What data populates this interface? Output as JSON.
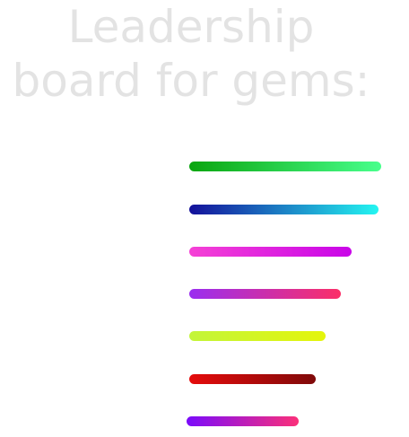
{
  "title": {
    "line1": "Leadership",
    "line2": "board for gems:"
  },
  "leaderboard": {
    "max_value": 1.0,
    "bars": [
      {
        "value": 1.0,
        "color_start": "#0aa50f",
        "color_end": "#48ff8c"
      },
      {
        "value": 0.986,
        "color_start": "#14109a",
        "color_end": "#24f5f1"
      },
      {
        "value": 0.845,
        "color_start": "#f541d5",
        "color_end": "#c905e8"
      },
      {
        "value": 0.79,
        "color_start": "#9a2ef0",
        "color_end": "#fb2f68"
      },
      {
        "value": 0.71,
        "color_start": "#c3f53a",
        "color_end": "#e4f50b"
      },
      {
        "value": 0.66,
        "color_start": "#e50b0b",
        "color_end": "#7f0a0a"
      },
      {
        "value": 0.585,
        "color_start": "#7a0bfb",
        "color_end": "#fb3079"
      }
    ]
  }
}
